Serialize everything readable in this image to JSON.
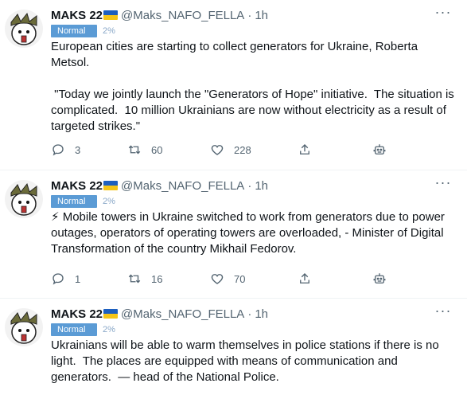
{
  "tweets": [
    {
      "name": "MAKS 22",
      "handle": "@Maks_NAFO_FELLA",
      "dot": "·",
      "time": "1h",
      "badge": "Normal",
      "percent": "2%",
      "text": "European cities are starting to collect generators for Ukraine, Roberta Metsol.\n\n \"Today we jointly launch the \"Generators of Hope\" initiative.  The situation is complicated.  10 million Ukrainians are now without electricity as a result of targeted strikes.\"",
      "replies": "3",
      "retweets": "60",
      "likes": "228"
    },
    {
      "name": "MAKS 22",
      "handle": "@Maks_NAFO_FELLA",
      "dot": "·",
      "time": "1h",
      "badge": "Normal",
      "percent": "2%",
      "text": "⚡ Mobile towers in Ukraine switched to work from generators due to power outages, operators of operating towers are overloaded, - Minister of Digital Transformation of the country Mikhail Fedorov.",
      "replies": "1",
      "retweets": "16",
      "likes": "70"
    },
    {
      "name": "MAKS 22",
      "handle": "@Maks_NAFO_FELLA",
      "dot": "·",
      "time": "1h",
      "badge": "Normal",
      "percent": "2%",
      "text": "Ukrainians will be able to warm themselves in police stations if there is no light.  The places are equipped with means of communication and generators.  — head of the National Police."
    }
  ],
  "icons": {
    "reply": "reply-icon",
    "retweet": "retweet-icon",
    "like": "heart-icon",
    "share": "share-icon",
    "bot": "robot-icon",
    "more": "more-icon"
  },
  "colors": {
    "badge": "#5b9bd5",
    "secondary_text": "#536471",
    "flag_blue": "#1d5fbf",
    "flag_yellow": "#f5c518"
  }
}
